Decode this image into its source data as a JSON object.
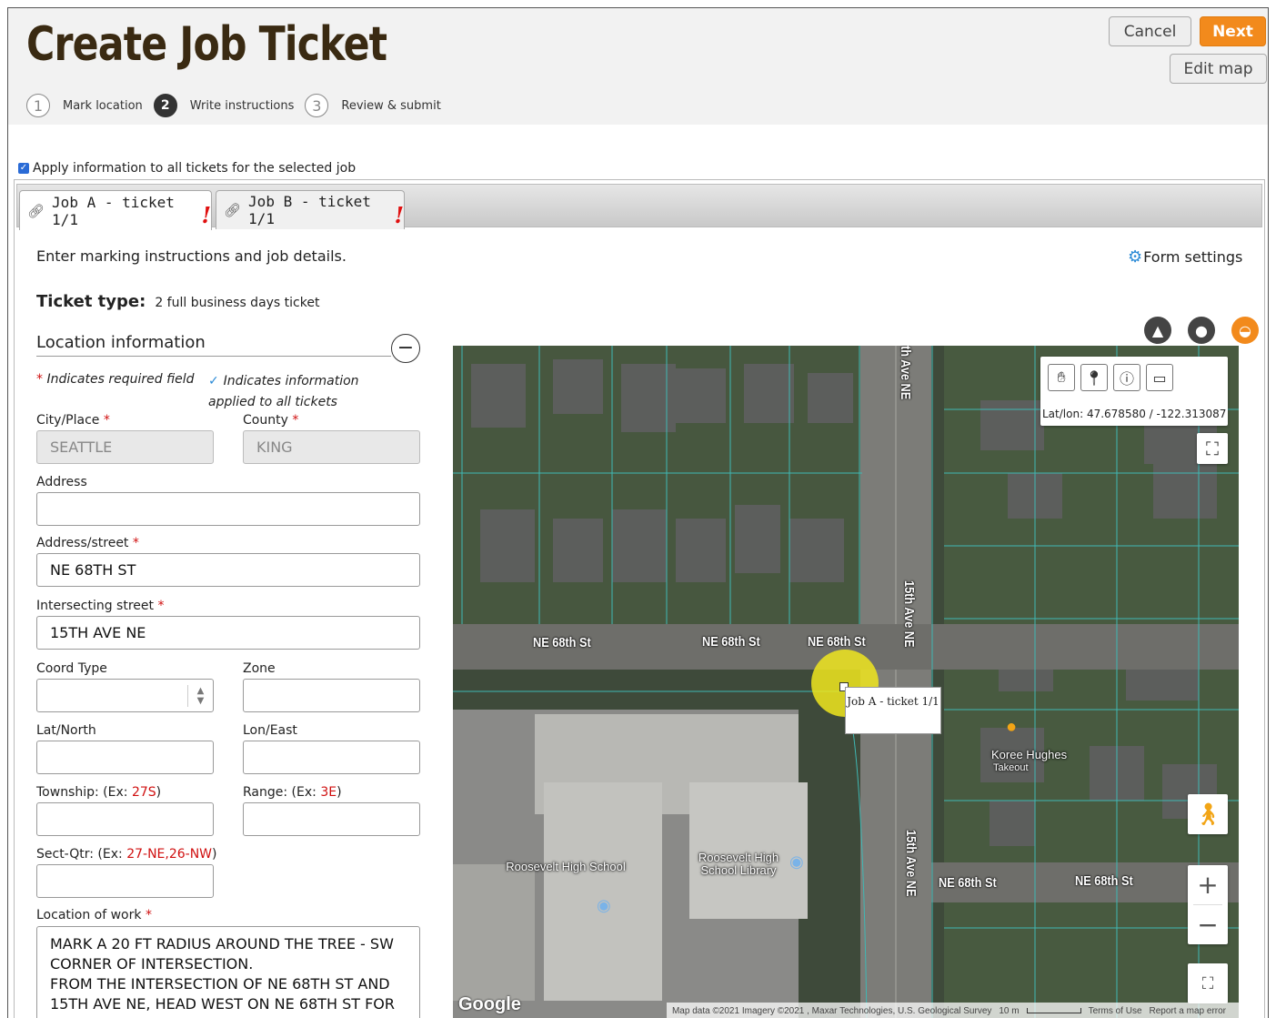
{
  "header": {
    "title": "Create Job Ticket",
    "buttons": {
      "cancel": "Cancel",
      "next": "Next",
      "edit_map": "Edit map"
    },
    "steps": [
      {
        "number": "1",
        "label": "Mark location"
      },
      {
        "number": "2",
        "label": "Write instructions"
      },
      {
        "number": "3",
        "label": "Review & submit"
      }
    ]
  },
  "apply_all": {
    "label": "Apply information to all tickets for the selected job",
    "checked": true
  },
  "tabs": [
    {
      "label": "Job A - ticket 1/1",
      "warning": "!"
    },
    {
      "label": "Job B - ticket 1/1",
      "warning": "!"
    }
  ],
  "form": {
    "intro": "Enter marking instructions and job details.",
    "form_settings": "Form settings",
    "ticket_type_label": "Ticket type:",
    "ticket_type_value": "2 full business days ticket",
    "section_title": "Location information",
    "required_note": "Indicates required field",
    "applied_note": "Indicates information applied to all tickets",
    "fields": {
      "city": {
        "label": "City/Place",
        "value": "SEATTLE"
      },
      "county": {
        "label": "County",
        "value": "KING"
      },
      "address": {
        "label": "Address",
        "value": ""
      },
      "address_street": {
        "label": "Address/street",
        "value": "NE 68TH ST"
      },
      "intersecting_street": {
        "label": "Intersecting street",
        "value": "15TH AVE NE"
      },
      "coord_type": {
        "label": "Coord Type",
        "value": ""
      },
      "zone": {
        "label": "Zone",
        "value": ""
      },
      "lat_north": {
        "label": "Lat/North",
        "value": ""
      },
      "lon_east": {
        "label": "Lon/East",
        "value": ""
      },
      "township": {
        "label": "Township: (Ex: ",
        "example": "27S",
        "suffix": ")",
        "value": ""
      },
      "range": {
        "label": "Range: (Ex: ",
        "example": "3E",
        "suffix": ")",
        "value": ""
      },
      "sect_qtr": {
        "label": "Sect-Qtr: (Ex: ",
        "example": "27-NE,26-NW",
        "suffix": ")",
        "value": ""
      },
      "location_of_work": {
        "label": "Location of work",
        "value": "MARK A 20 FT RADIUS AROUND THE TREE - SW CORNER OF INTERSECTION.\nFROM THE INTERSECTION OF NE 68TH ST AND 15TH AVE NE, HEAD WEST ON NE 68TH ST FOR"
      }
    }
  },
  "map": {
    "latlon_label": "Lat/lon:",
    "lat": "47.678580",
    "lon": "-122.313087",
    "streets": [
      "NE 68th St",
      "NE 68th St",
      "NE 68th St",
      "NE 68th St",
      "NE 68th St",
      "15th Ave NE",
      "15th Ave NE",
      "th Ave NE"
    ],
    "pois": [
      "Roosevelt High School",
      "Roosevelt High School Library",
      "Koree Hughes",
      "Takeout"
    ],
    "marker_popup": "Job A - ticket 1/1",
    "google": "Google",
    "attribution": {
      "data": "Map data ©2021 Imagery ©2021 , Maxar Technologies, U.S. Geological Survey",
      "scale": "10 m",
      "terms": "Terms of Use",
      "report": "Report a map error"
    },
    "colors": {
      "parcel_lines": "#3fb8b4",
      "marker": "#f0e61e",
      "accent": "#f28a1c"
    }
  }
}
